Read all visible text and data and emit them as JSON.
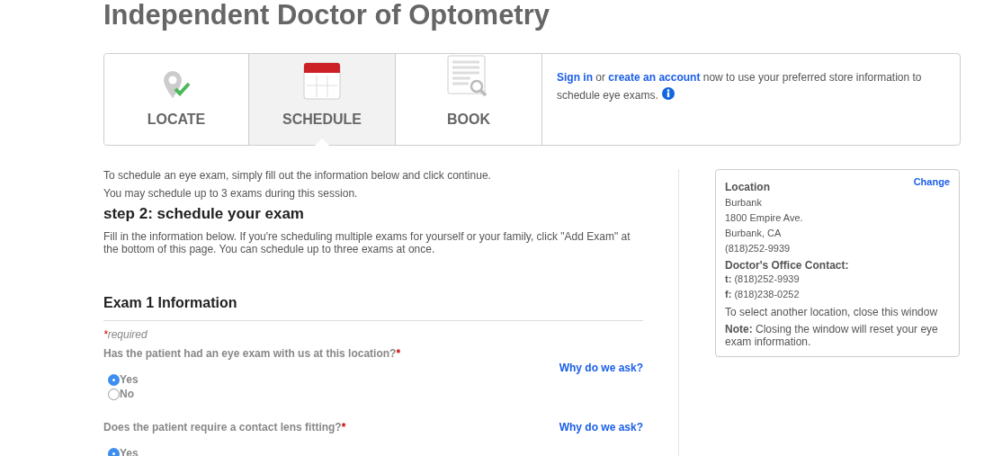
{
  "page_title": "Independent Doctor of Optometry",
  "steps": [
    {
      "label": "LOCATE",
      "kind": "locate",
      "selected": false
    },
    {
      "label": "SCHEDULE",
      "kind": "schedule",
      "selected": true
    },
    {
      "label": "BOOK",
      "kind": "book",
      "selected": false
    }
  ],
  "sign_in_message": [
    {
      "kind": "link",
      "text": "Sign in"
    },
    {
      "kind": "text",
      "text": " or "
    },
    {
      "kind": "link",
      "text": "create an account"
    },
    {
      "kind": "text",
      "text": " now to use your preferred store information to schedule eye exams."
    }
  ],
  "intro": [
    "To schedule an eye exam, simply fill out the information below and click continue.",
    "You may schedule up to 3 exams during this session."
  ],
  "step_heading": "step 2: schedule your exam",
  "instructions": "Fill in the information below. If you're scheduling multiple exams for yourself or your family, click \"Add Exam\" at the bottom of this page. You can schedule up to three exams at once.",
  "exam_heading": "Exam 1 Information",
  "required_note": {
    "mark": "*",
    "text": "required"
  },
  "questions": [
    {
      "label": "Has the patient had an eye exam with us at this location?",
      "required_mark": "*",
      "help_link": "Why do we ask?",
      "options": [
        {
          "label": "Yes",
          "selected": true
        },
        {
          "label": "No",
          "selected": false
        }
      ]
    },
    {
      "label": "Does the patient require a contact lens fitting?",
      "required_mark": "*",
      "help_link": "Why do we ask?",
      "options": [
        {
          "label": "Yes",
          "selected": true
        }
      ]
    }
  ],
  "location_card": {
    "heading": "Location",
    "change_link": "Change",
    "address": [
      "Burbank",
      "1800 Empire Ave.",
      "Burbank, CA",
      "(818)252-9939"
    ],
    "contact_heading": "Doctor's Office Contact:",
    "contact": [
      "**t:** (818)252-9939",
      "**f:** (818)238-0252"
    ],
    "notes": [
      "To select another location, close this window",
      "**Note:** Closing the window will reset your eye exam information."
    ]
  }
}
